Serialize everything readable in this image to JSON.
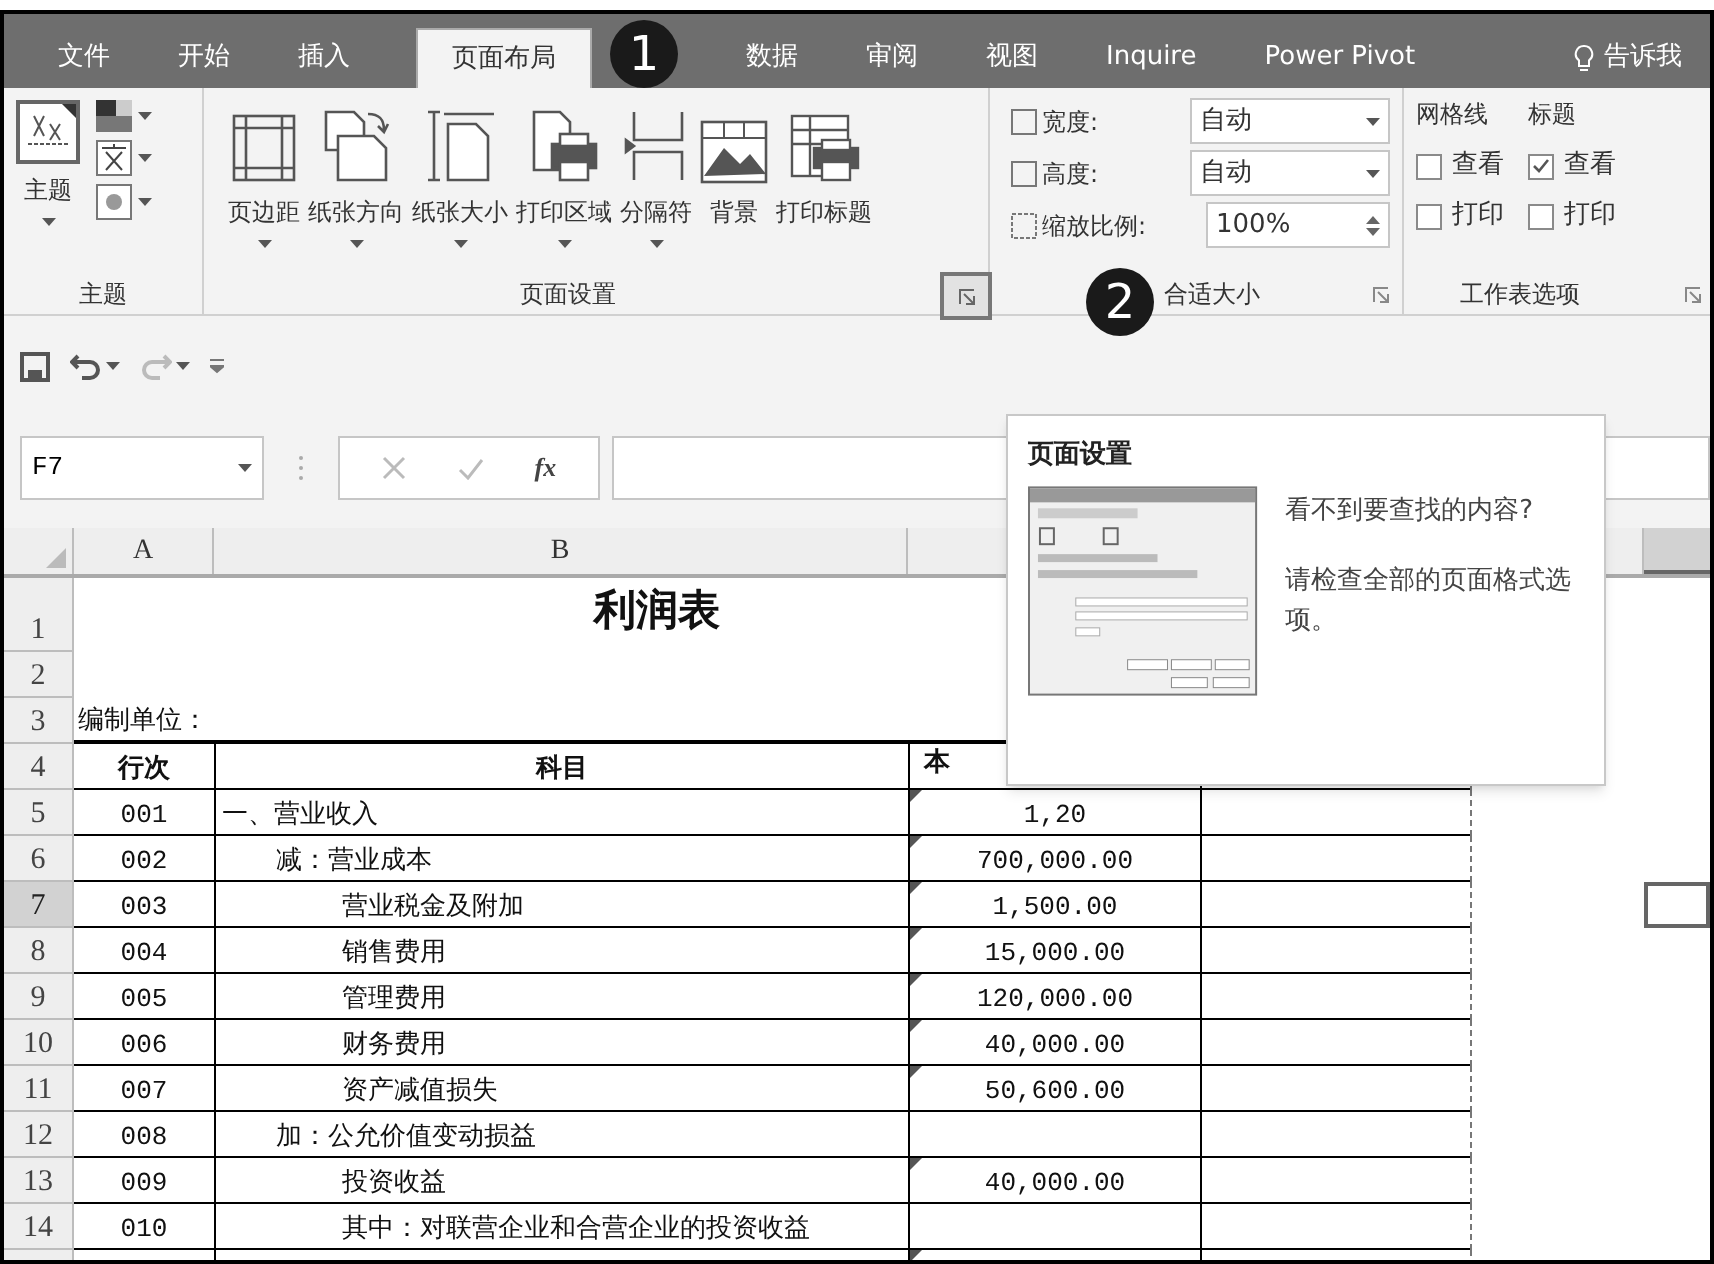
{
  "ribbon_tabs": [
    {
      "label": "文件",
      "selected": false,
      "kind": "tab"
    },
    {
      "label": "开始",
      "selected": false,
      "kind": "tab"
    },
    {
      "label": "插入",
      "selected": false,
      "kind": "tab"
    },
    {
      "label": "页面布局",
      "selected": true,
      "kind": "tab"
    },
    {
      "label": "数据",
      "selected": false,
      "kind": "tab"
    },
    {
      "label": "审阅",
      "selected": false,
      "kind": "tab"
    },
    {
      "label": "视图",
      "selected": false,
      "kind": "tab"
    },
    {
      "label": "Inquire",
      "selected": false,
      "kind": "tab"
    },
    {
      "label": "Power Pivot",
      "selected": false,
      "kind": "tab"
    },
    {
      "label": "告诉我",
      "selected": false,
      "kind": "tell_me"
    }
  ],
  "callouts": [
    {
      "text": "1"
    },
    {
      "text": "2"
    }
  ],
  "ribbon": {
    "theme_group": {
      "button": "主题",
      "label": "主题"
    },
    "page_setup": {
      "label": "页面设置",
      "buttons": [
        {
          "label": "页边距",
          "dropdown": true
        },
        {
          "label": "纸张方向",
          "dropdown": true
        },
        {
          "label": "纸张大小",
          "dropdown": true
        },
        {
          "label": "打印区域",
          "dropdown": true
        },
        {
          "label": "分隔符",
          "dropdown": true
        },
        {
          "label": "背景",
          "dropdown": false
        },
        {
          "label": "打印标题",
          "dropdown": false
        }
      ]
    },
    "scale_to_fit": {
      "label_end": "合适大小",
      "fields": [
        {
          "label": "宽度:",
          "value": "自动",
          "kind": "dropdown"
        },
        {
          "label": "高度:",
          "value": "自动",
          "kind": "dropdown"
        },
        {
          "label": "缩放比例:",
          "value": "100%",
          "kind": "spinner"
        }
      ]
    },
    "sheet_options": {
      "label": "工作表选项",
      "columns": [
        {
          "heading": "网格线",
          "options": [
            {
              "label": "查看",
              "checked": false
            },
            {
              "label": "打印",
              "checked": false
            }
          ]
        },
        {
          "heading": "标题",
          "options": [
            {
              "label": "查看",
              "checked": true
            },
            {
              "label": "打印",
              "checked": false
            }
          ]
        }
      ]
    }
  },
  "formula_bar": {
    "name_box": "F7",
    "function_label": "fx"
  },
  "tooltip": {
    "title": "页面设置",
    "question": "看不到要查找的内容?",
    "hint": "请检查全部的页面格式选项。"
  },
  "sheet": {
    "columns": [
      "A",
      "B"
    ],
    "rows": [
      {
        "number": "1",
        "kind": "title",
        "text": "利润表",
        "selected": false
      },
      {
        "number": "2",
        "kind": "blank",
        "selected": false
      },
      {
        "number": "3",
        "kind": "note",
        "text": "编制单位：",
        "selected": false
      },
      {
        "number": "4",
        "kind": "header",
        "line": "行次",
        "item": {
          "text": "科目"
        },
        "amount": "本",
        "selected": false
      },
      {
        "number": "5",
        "kind": "entry",
        "line": "001",
        "item": {
          "text": "一、营业收入",
          "kind": "heading"
        },
        "amount": "1,20",
        "marker": true,
        "selected": false
      },
      {
        "number": "6",
        "kind": "entry",
        "line": "002",
        "item": {
          "text": "减：营业成本",
          "kind": "group"
        },
        "amount": "700,000.00",
        "marker": true,
        "selected": false
      },
      {
        "number": "7",
        "kind": "entry",
        "line": "003",
        "item": {
          "text": "营业税金及附加",
          "kind": "item"
        },
        "amount": "1,500.00",
        "marker": true,
        "selected": true
      },
      {
        "number": "8",
        "kind": "entry",
        "line": "004",
        "item": {
          "text": "销售费用",
          "kind": "item"
        },
        "amount": "15,000.00",
        "marker": true,
        "selected": false
      },
      {
        "number": "9",
        "kind": "entry",
        "line": "005",
        "item": {
          "text": "管理费用",
          "kind": "item"
        },
        "amount": "120,000.00",
        "marker": true,
        "selected": false
      },
      {
        "number": "10",
        "kind": "entry",
        "line": "006",
        "item": {
          "text": "财务费用",
          "kind": "item"
        },
        "amount": "40,000.00",
        "marker": true,
        "selected": false
      },
      {
        "number": "11",
        "kind": "entry",
        "line": "007",
        "item": {
          "text": "资产减值损失",
          "kind": "item"
        },
        "amount": "50,600.00",
        "marker": true,
        "selected": false
      },
      {
        "number": "12",
        "kind": "entry",
        "line": "008",
        "item": {
          "text": "加：公允价值变动损益",
          "kind": "group"
        },
        "marker": false,
        "selected": false
      },
      {
        "number": "13",
        "kind": "entry",
        "line": "009",
        "item": {
          "text": "投资收益",
          "kind": "item"
        },
        "amount": "40,000.00",
        "marker": true,
        "selected": false
      },
      {
        "number": "14",
        "kind": "entry",
        "line": "010",
        "item": {
          "text": "其中：对联营企业和合营企业的投资收益",
          "kind": "item"
        },
        "marker": false,
        "selected": false
      },
      {
        "kind": "entry",
        "marker": true,
        "selected": false
      }
    ]
  }
}
